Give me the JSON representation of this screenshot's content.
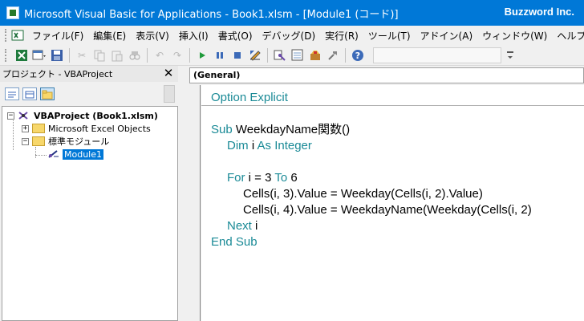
{
  "window": {
    "title": "Microsoft Visual Basic for Applications - Book1.xlsm - [Module1 (コード)]",
    "brand": "Buzzword Inc."
  },
  "menu": {
    "items": [
      "ファイル(F)",
      "編集(E)",
      "表示(V)",
      "挿入(I)",
      "書式(O)",
      "デバッグ(D)",
      "実行(R)",
      "ツール(T)",
      "アドイン(A)",
      "ウィンドウ(W)",
      "ヘルプ(H)"
    ]
  },
  "toolbar": {
    "icons": [
      "excel-icon",
      "insert-icon",
      "save-icon",
      "cut-icon",
      "copy-icon",
      "paste-icon",
      "find-icon",
      "undo-icon",
      "redo-icon",
      "run-icon",
      "break-icon",
      "reset-icon",
      "design-mode-icon",
      "project-explorer-icon",
      "properties-icon",
      "object-browser-icon",
      "toolbox-icon",
      "help-icon"
    ]
  },
  "project": {
    "title": "プロジェクト - VBAProject",
    "close_glyph": "✕",
    "tree": {
      "root": "VBAProject (Book1.xlsm)",
      "excel_objects": "Microsoft Excel Objects",
      "standard_modules": "標準モジュール",
      "module": "Module1"
    }
  },
  "code": {
    "object_dropdown": "(General)",
    "lines": [
      {
        "kw1": "Option Explicit",
        "rest": ""
      },
      {
        "kw1": "Sub",
        "rest": " WeekdayName関数()"
      },
      {
        "kw1": "Dim",
        "mid": " i ",
        "kw2": "As Integer"
      },
      {
        "kw1": "For",
        "mid": " i = 3 ",
        "kw2": "To",
        "rest": " 6"
      },
      {
        "text": "Cells(i, 3).Value = Weekday(Cells(i, 2).Value)"
      },
      {
        "text": "Cells(i, 4).Value = WeekdayName(Weekday(Cells(i, 2)"
      },
      {
        "kw1": "Next",
        "rest": " i"
      },
      {
        "kw1": "End Sub"
      }
    ]
  }
}
